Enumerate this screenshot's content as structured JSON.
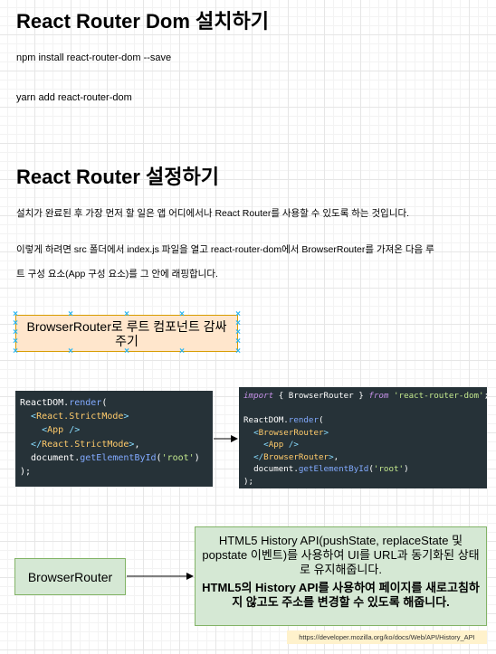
{
  "section1": {
    "title": "React Router Dom 설치하기",
    "npm_cmd": "npm install react-router-dom --save",
    "yarn_cmd": "yarn add react-router-dom"
  },
  "section2": {
    "title": "React Router 설정하기",
    "line1": "설치가 완료된 후 가장 먼저 할 일은 앱 어디에서나 React Router를 사용할 수 있도록 하는 것입니다.",
    "line2": "이렇게 하려면 src 폴더에서 index.js 파일을 열고 react-router-dom에서 BrowserRouter를 가져온 다음 루",
    "line3": "트 구성 요소(App 구성 요소)를 그 안에 래핑합니다."
  },
  "selected_box": {
    "label": "BrowserRouter로 루트 컴포넌트 감싸주기"
  },
  "code_before": {
    "line1": [
      "ReactDOM.",
      "render",
      "("
    ],
    "line2": [
      "  ",
      "<",
      "React.StrictMode",
      ">"
    ],
    "line3": [
      "    ",
      "<",
      "App",
      " />"
    ],
    "line4": [
      "  ",
      "</",
      "React.StrictMode",
      ">",
      ","
    ],
    "line5": [
      "  document.",
      "getElementById",
      "(",
      "'root'",
      ")"
    ],
    "line6": [
      ");"
    ]
  },
  "code_after": {
    "line1": [
      "import",
      " { BrowserRouter } ",
      "from",
      " ",
      "'react-router-dom'",
      ";"
    ],
    "line2": [
      "ReactDOM.",
      "render",
      "("
    ],
    "line3": [
      "  ",
      "<",
      "BrowserRouter",
      ">"
    ],
    "line4": [
      "    ",
      "<",
      "App",
      " />"
    ],
    "line5": [
      "  ",
      "</",
      "BrowserRouter",
      ">",
      ","
    ],
    "line6": [
      "  document.",
      "getElementById",
      "(",
      "'root'",
      ")"
    ],
    "line7": [
      ");"
    ]
  },
  "browser_router_node": {
    "label": "BrowserRouter"
  },
  "info_node": {
    "text1": "HTML5 History API(pushState, replaceState 및 popstate 이벤트)를 사용하여 UI를 URL과 동기화된 상태로 유지해줍니다.",
    "text2": "HTML5의 History API를 사용하여 페이지를 새로고침하지 않고도 주소를 변경할 수 있도록 해줍니다."
  },
  "source_note": {
    "text": "https://developer.mozilla.org/ko/docs/Web/API/History_API"
  },
  "colors": {
    "code_bg": "#263238",
    "selected_fill": "#ffe6cc",
    "selected_stroke": "#d79b00",
    "node_fill": "#d5e8d4",
    "node_stroke": "#82b366",
    "note_fill": "#fff2cc",
    "handle": "#29b6f2"
  }
}
